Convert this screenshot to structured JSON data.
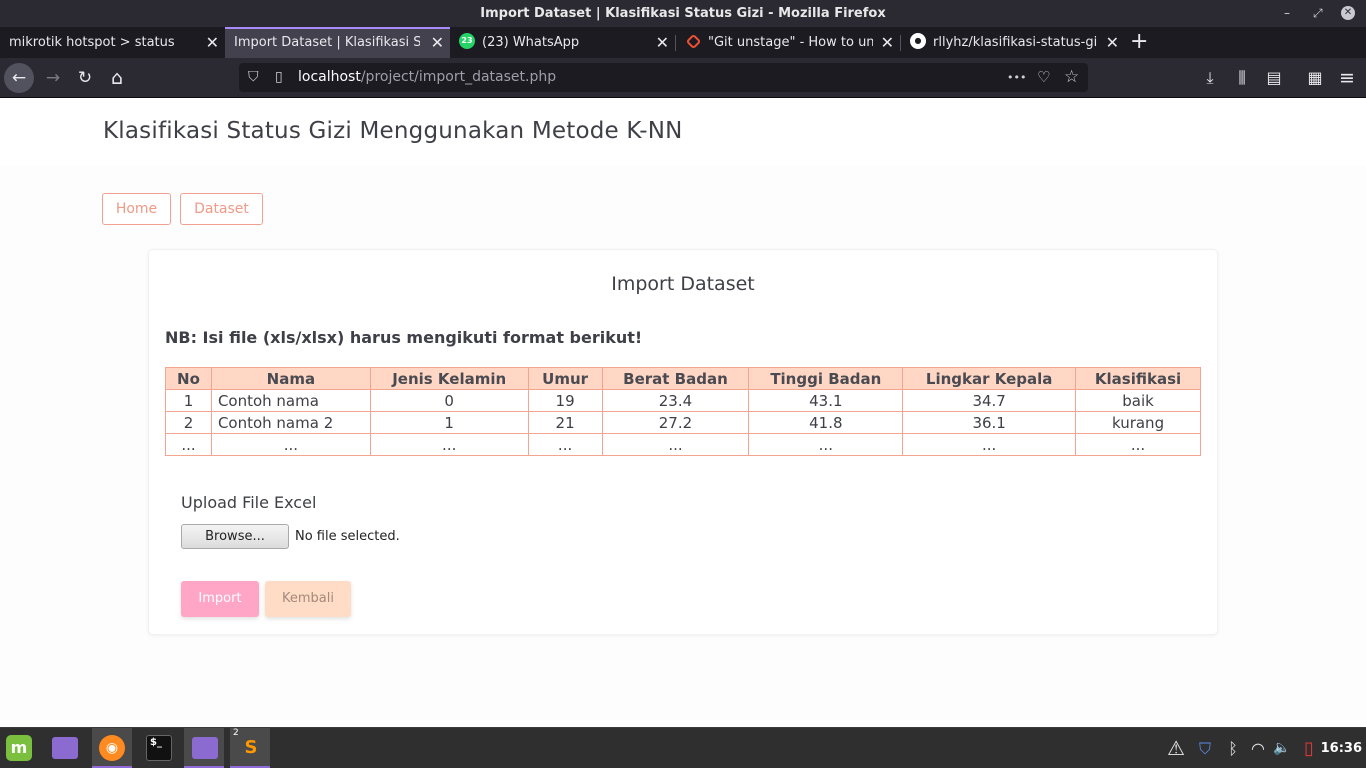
{
  "window": {
    "title": "Import Dataset | Klasifikasi Status Gizi - Mozilla Firefox",
    "minimize_glyph": "–",
    "maximize_glyph": "⤢",
    "close_glyph": "✕"
  },
  "tabs": [
    {
      "title": "mikrotik hotspot > status",
      "icon": "none"
    },
    {
      "title": "Import Dataset | Klasifikasi Sta",
      "icon": "none"
    },
    {
      "title": "(23) WhatsApp",
      "icon": "whatsapp-icon",
      "badge": "23"
    },
    {
      "title": "\"Git unstage\" - How to unst",
      "icon": "git-icon"
    },
    {
      "title": "rllyhz/klasifikasi-status-gizi",
      "icon": "github-icon"
    }
  ],
  "tab_close_glyph": "✕",
  "new_tab_glyph": "+",
  "nav": {
    "back_glyph": "←",
    "forward_glyph": "→",
    "reload_glyph": "↻",
    "home_glyph": "⌂",
    "url_host": "localhost",
    "url_path": "/project/import_dataset.php",
    "more_glyph": "•••",
    "pocket_glyph": "♡",
    "star_glyph": "☆",
    "download_glyph": "⤓",
    "library_glyph": "⫼",
    "sidebar_glyph": "▤",
    "extensions_glyph": "▦",
    "menu_glyph": "≡"
  },
  "page": {
    "site_title": "Klasifikasi Status Gizi Menggunakan Metode K-NN",
    "nav_links": [
      "Home",
      "Dataset"
    ],
    "card_title": "Import Dataset",
    "note": "NB: Isi file (xls/xlsx) harus mengikuti format berikut!",
    "table": {
      "headers": [
        "No",
        "Nama",
        "Jenis Kelamin",
        "Umur",
        "Berat Badan",
        "Tinggi Badan",
        "Lingkar Kepala",
        "Klasifikasi"
      ],
      "rows": [
        [
          "1",
          "Contoh nama",
          "0",
          "19",
          "23.4",
          "43.1",
          "34.7",
          "baik"
        ],
        [
          "2",
          "Contoh nama 2",
          "1",
          "21",
          "27.2",
          "41.8",
          "36.1",
          "kurang"
        ],
        [
          "...",
          "...",
          "...",
          "...",
          "...",
          "...",
          "...",
          "..."
        ]
      ]
    },
    "upload_label": "Upload File Excel",
    "browse_button": "Browse...",
    "file_status": "No file selected.",
    "import_button": "Import",
    "back_button": "Kembali"
  },
  "taskbar": {
    "apps": [
      {
        "name": "linux-mint-menu-icon",
        "glyph": "m"
      },
      {
        "name": "file-manager-icon",
        "glyph": ""
      },
      {
        "name": "firefox-icon",
        "glyph": "◉"
      },
      {
        "name": "terminal-icon",
        "glyph": "$_"
      },
      {
        "name": "folder-icon",
        "glyph": ""
      },
      {
        "name": "sublime-text-icon",
        "glyph": "S",
        "badge": "2"
      }
    ],
    "tray": {
      "warning_glyph": "⚠",
      "shield_glyph": "⛉",
      "bluetooth_glyph": "ᛒ",
      "wifi_glyph": "◠",
      "volume_glyph": "🔈",
      "battery_glyph": "▯"
    },
    "clock": "16:36"
  },
  "colors": {
    "accent": "#f09a88",
    "table_header_bg": "#ffd7c4",
    "import_button": "#ffa5c6",
    "back_button": "#ffdcc6"
  }
}
